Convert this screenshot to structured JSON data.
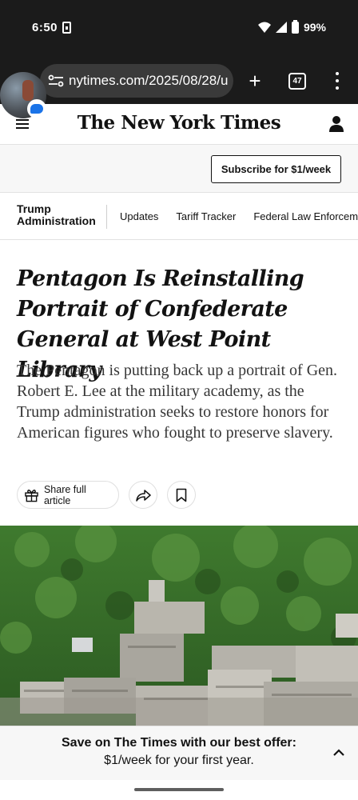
{
  "status_bar": {
    "time": "6:50",
    "battery": "99%"
  },
  "browser": {
    "url": "nytimes.com/2025/08/28/u",
    "tab_count": "47",
    "new_tab_label": "+"
  },
  "header": {
    "logo": "The New York Times"
  },
  "subscribe": {
    "button_label": "Subscribe for $1/week"
  },
  "section_nav": {
    "title_line1": "Trump",
    "title_line2": "Administration",
    "links": [
      "Updates",
      "Tariff Tracker",
      "Federal Law Enforcement"
    ]
  },
  "article": {
    "headline": "Pentagon Is Reinstalling Portrait of Confederate General at West Point Library",
    "summary": "The Pentagon is putting back up a portrait of Gen. Robert E. Lee at the military academy, as the Trump administration seeks to restore honors for American figures who fought to preserve slavery.",
    "share_label": "Share full article"
  },
  "offer": {
    "line1": "Save on The Times with our best offer:",
    "line2": "$1/week for your first year."
  },
  "colors": {
    "status_bg": "#1b1b1b",
    "url_pill": "#3a3a3a",
    "text": "#121212",
    "band": "#f7f7f7"
  }
}
